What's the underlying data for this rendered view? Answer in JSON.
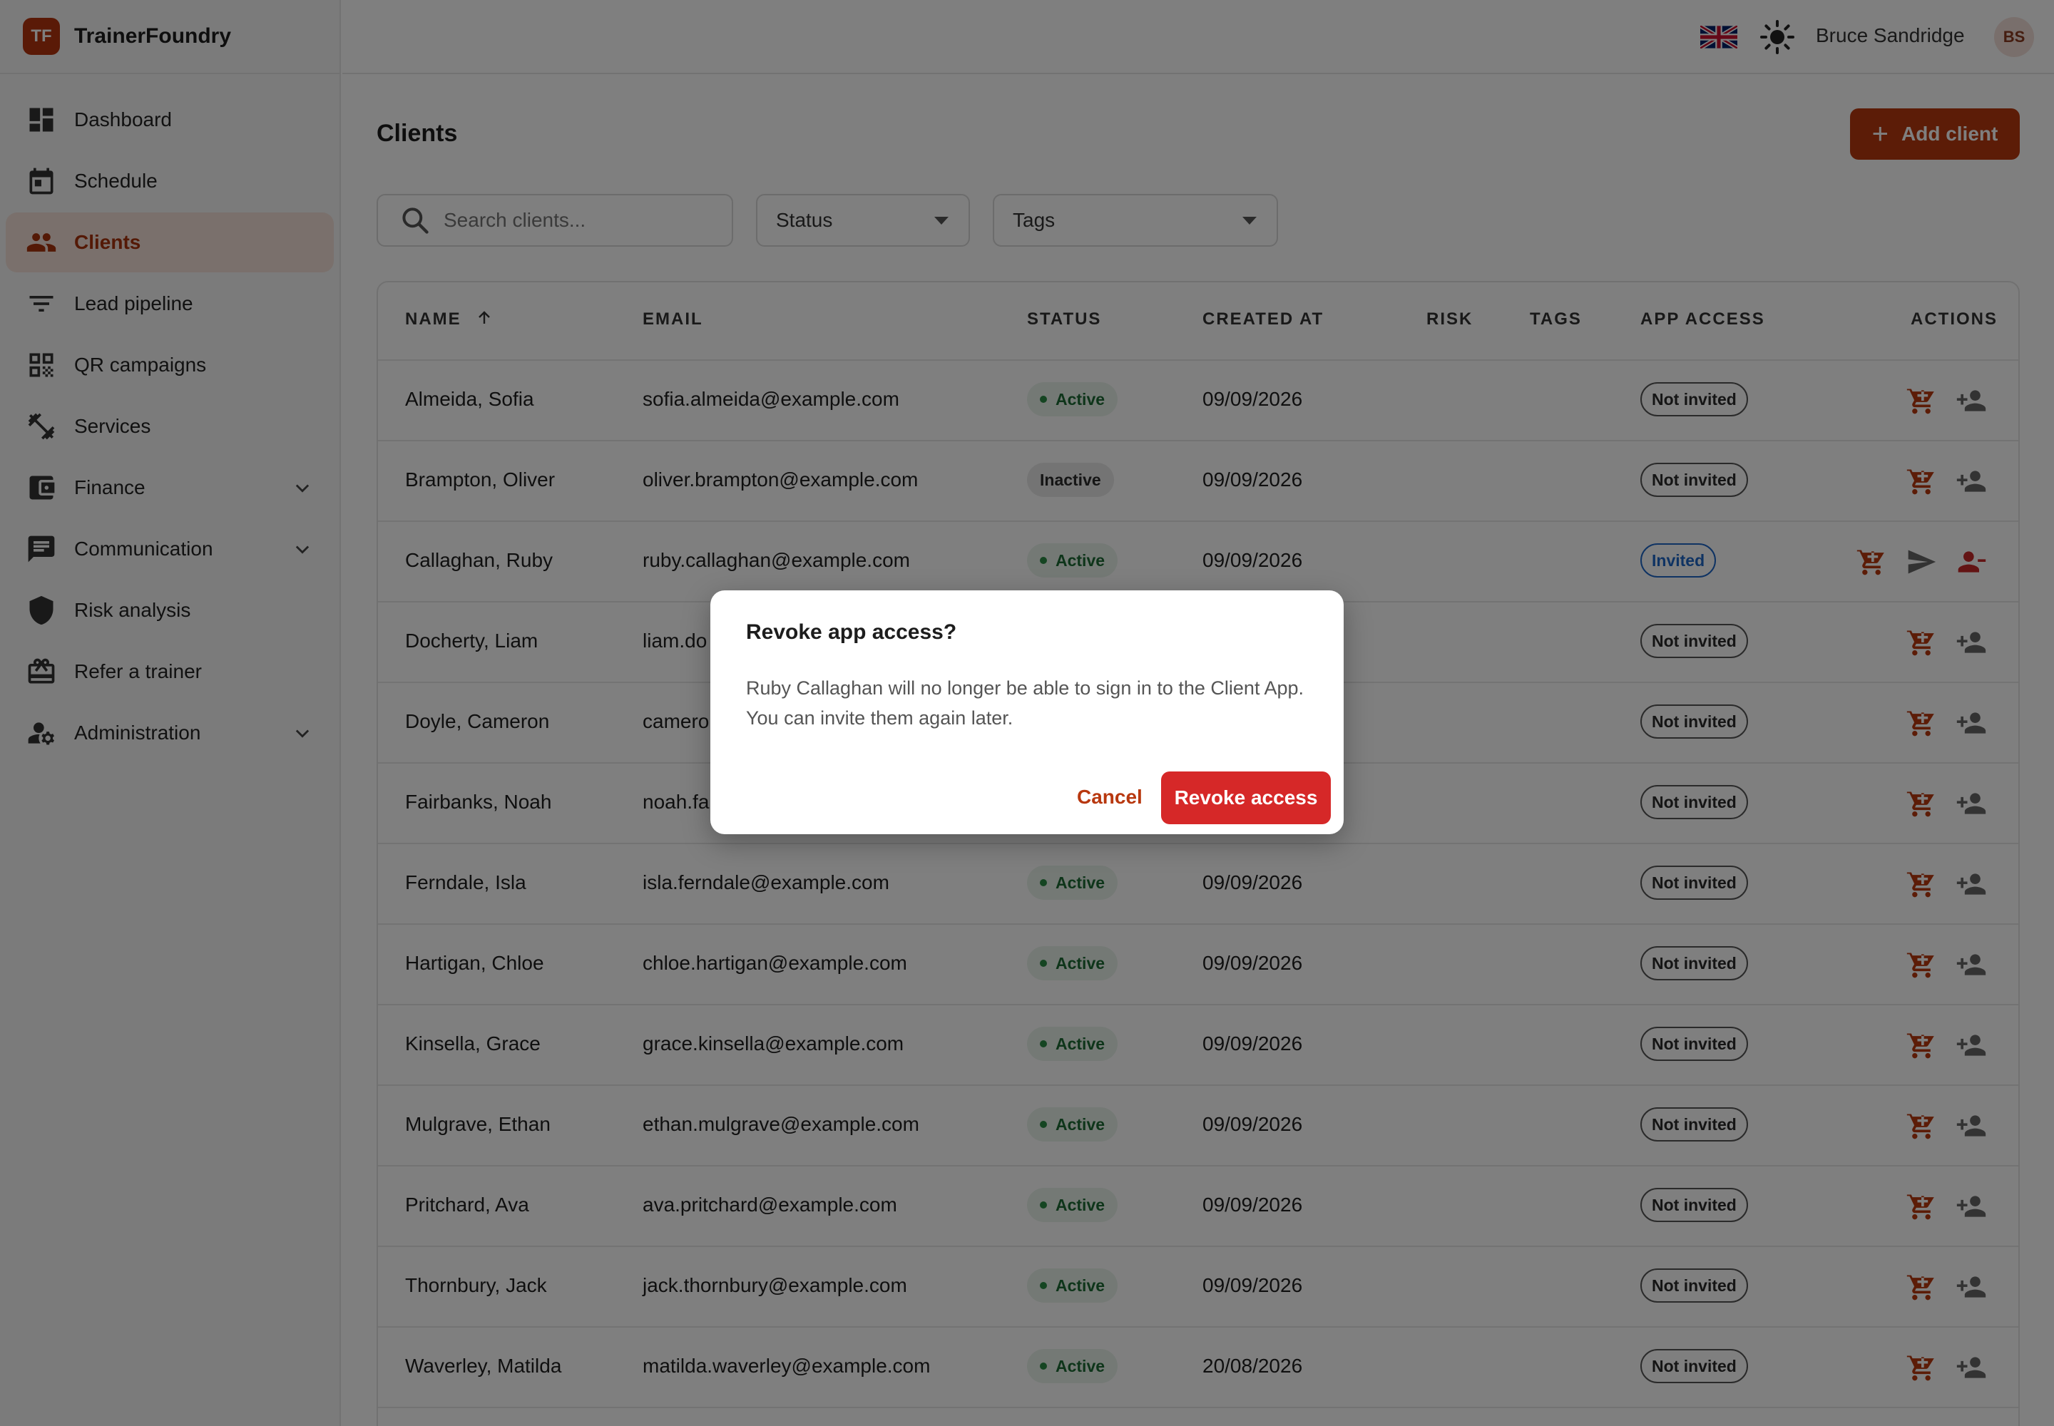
{
  "app": {
    "logo_initials": "TF",
    "name": "TrainerFoundry"
  },
  "sidebar": {
    "items": [
      {
        "label": "Dashboard",
        "icon": "dashboard-icon"
      },
      {
        "label": "Schedule",
        "icon": "calendar-icon"
      },
      {
        "label": "Clients",
        "icon": "people-icon",
        "active": true
      },
      {
        "label": "Lead pipeline",
        "icon": "filter-icon"
      },
      {
        "label": "QR campaigns",
        "icon": "qr-code-icon"
      },
      {
        "label": "Services",
        "icon": "dumbbell-icon"
      },
      {
        "label": "Finance",
        "icon": "wallet-icon",
        "expandable": true
      },
      {
        "label": "Communication",
        "icon": "chat-icon",
        "expandable": true
      },
      {
        "label": "Risk analysis",
        "icon": "shield-icon"
      },
      {
        "label": "Refer a trainer",
        "icon": "gift-card-icon"
      },
      {
        "label": "Administration",
        "icon": "admin-user-icon",
        "expandable": true
      }
    ]
  },
  "topbar": {
    "language_icon": "uk-flag-icon",
    "theme_icon": "sun-icon",
    "user_name": "Bruce Sandridge",
    "user_initials": "BS"
  },
  "page": {
    "title": "Clients",
    "add_button_label": "Add client"
  },
  "filters": {
    "search_placeholder": "Search clients...",
    "status_label": "Status",
    "tags_label": "Tags"
  },
  "table": {
    "headers": {
      "name": "NAME",
      "email": "EMAIL",
      "status": "STATUS",
      "created_at": "CREATED AT",
      "risk": "RISK",
      "tags": "TAGS",
      "app_access": "APP ACCESS",
      "actions": "ACTIONS"
    },
    "sort": {
      "column": "name",
      "direction": "ascending"
    },
    "rows": [
      {
        "name": "Almeida, Sofia",
        "email": "sofia.almeida@example.com",
        "status": "Active",
        "created_at": "09/09/2026",
        "app_access": "Not invited"
      },
      {
        "name": "Brampton, Oliver",
        "email": "oliver.brampton@example.com",
        "status": "Inactive",
        "created_at": "09/09/2026",
        "app_access": "Not invited"
      },
      {
        "name": "Callaghan, Ruby",
        "email": "ruby.callaghan@example.com",
        "status": "Active",
        "created_at": "09/09/2026",
        "app_access": "Invited"
      },
      {
        "name": "Docherty, Liam",
        "email": "liam.do",
        "status": "",
        "created_at": "",
        "app_access": "Not invited"
      },
      {
        "name": "Doyle, Cameron",
        "email": "camero",
        "status": "",
        "created_at": "",
        "app_access": "Not invited"
      },
      {
        "name": "Fairbanks, Noah",
        "email": "noah.fa",
        "status": "",
        "created_at": "",
        "app_access": "Not invited"
      },
      {
        "name": "Ferndale, Isla",
        "email": "isla.ferndale@example.com",
        "status": "Active",
        "created_at": "09/09/2026",
        "app_access": "Not invited"
      },
      {
        "name": "Hartigan, Chloe",
        "email": "chloe.hartigan@example.com",
        "status": "Active",
        "created_at": "09/09/2026",
        "app_access": "Not invited"
      },
      {
        "name": "Kinsella, Grace",
        "email": "grace.kinsella@example.com",
        "status": "Active",
        "created_at": "09/09/2026",
        "app_access": "Not invited"
      },
      {
        "name": "Mulgrave, Ethan",
        "email": "ethan.mulgrave@example.com",
        "status": "Active",
        "created_at": "09/09/2026",
        "app_access": "Not invited"
      },
      {
        "name": "Pritchard, Ava",
        "email": "ava.pritchard@example.com",
        "status": "Active",
        "created_at": "09/09/2026",
        "app_access": "Not invited"
      },
      {
        "name": "Thornbury, Jack",
        "email": "jack.thornbury@example.com",
        "status": "Active",
        "created_at": "09/09/2026",
        "app_access": "Not invited"
      },
      {
        "name": "Waverley, Matilda",
        "email": "matilda.waverley@example.com",
        "status": "Active",
        "created_at": "20/08/2026",
        "app_access": "Not invited"
      }
    ]
  },
  "dialog": {
    "title": "Revoke app access?",
    "body": "Ruby Callaghan will no longer be able to sign in to the Client App. You can invite them again later.",
    "cancel_label": "Cancel",
    "confirm_label": "Revoke access"
  },
  "colors": {
    "brand": "#b8380f",
    "active_nav_bg": "#f4e1d8",
    "status_active": "#1d6b34",
    "invited": "#1e66c7",
    "danger": "#d62828",
    "overlay": "rgba(0,0,0,0.5)"
  }
}
